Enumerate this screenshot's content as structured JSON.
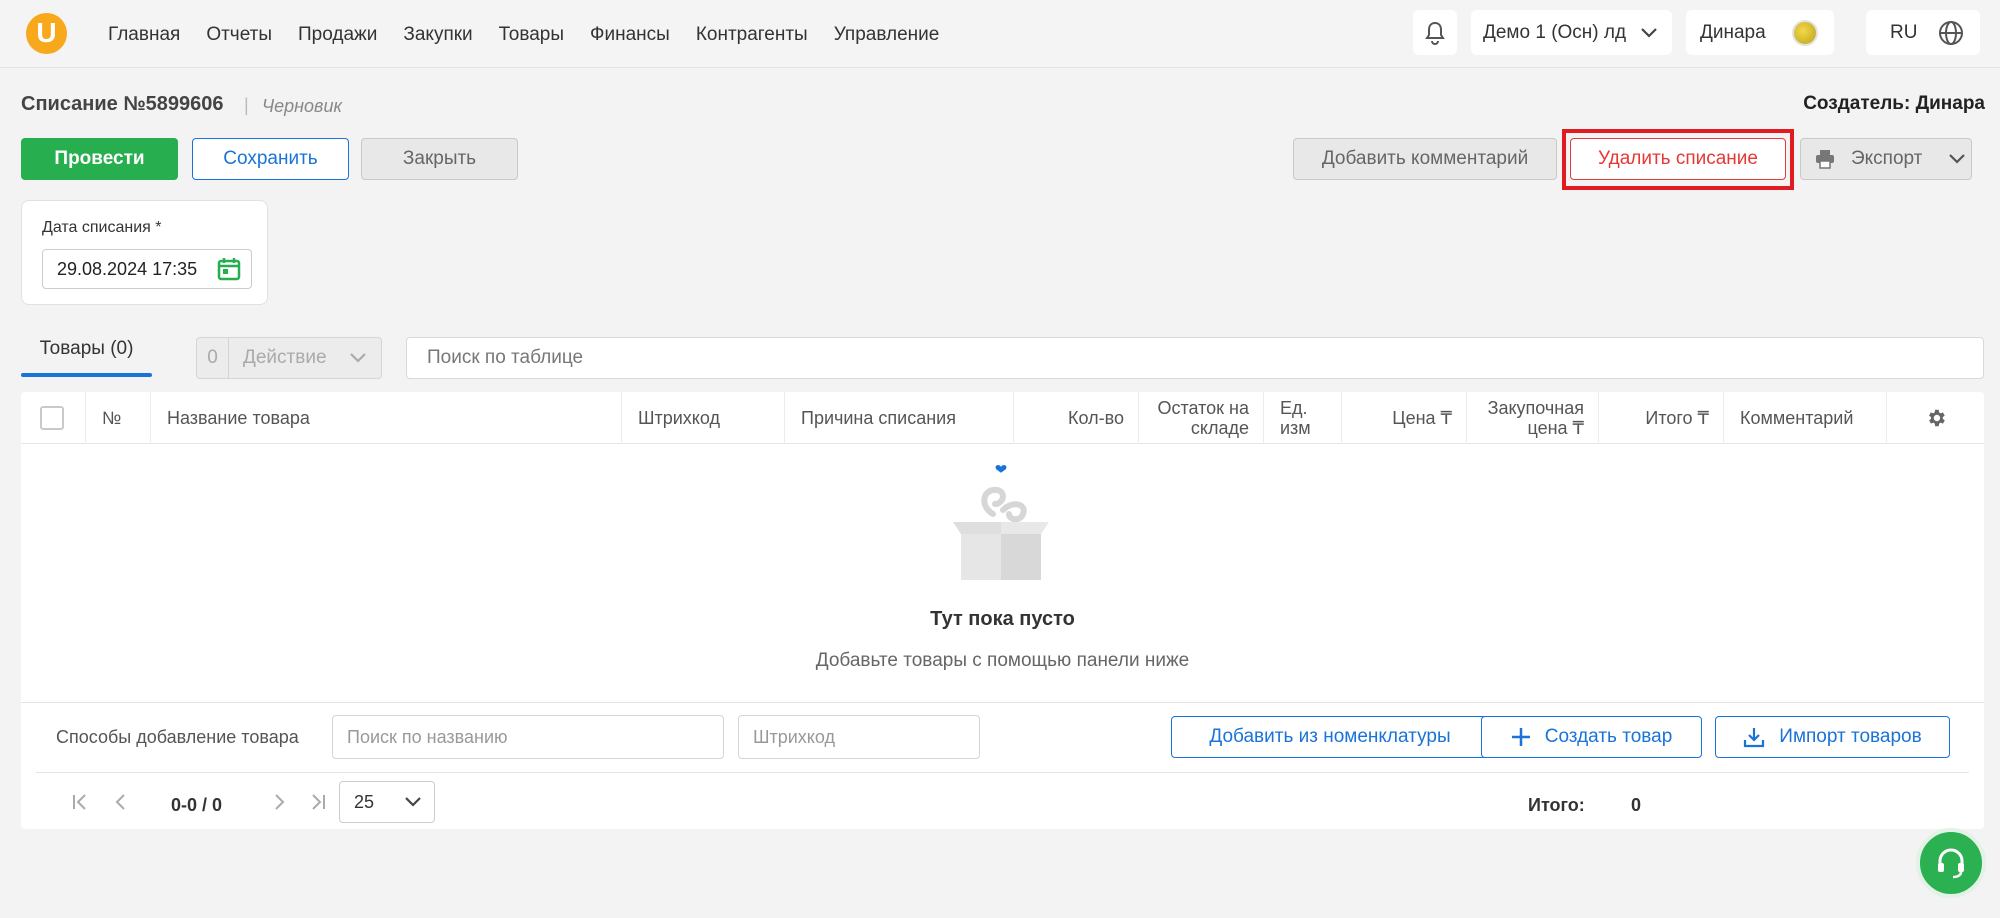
{
  "app": {
    "logo_letter": "U"
  },
  "nav": {
    "items": [
      "Главная",
      "Отчеты",
      "Продажи",
      "Закупки",
      "Товары",
      "Финансы",
      "Контрагенты",
      "Управление"
    ]
  },
  "header": {
    "company": "Демо 1 (Осн) лд",
    "user": "Динара",
    "lang": "RU"
  },
  "doc": {
    "title": "Списание №5899606",
    "separator": "|",
    "status": "Черновик",
    "creator": "Создатель: Динара"
  },
  "toolbar": {
    "conduct": "Провести",
    "save": "Сохранить",
    "close": "Закрыть",
    "add_comment": "Добавить комментарий",
    "delete": "Удалить списание",
    "export": "Экспорт"
  },
  "date_field": {
    "label": "Дата списания *",
    "value": "29.08.2024 17:35"
  },
  "tabs": {
    "goods": "Товары  (0)"
  },
  "action": {
    "count": "0",
    "label": "Действие"
  },
  "table_search": {
    "placeholder": "Поиск по таблице"
  },
  "table": {
    "columns": {
      "num": "№",
      "name": "Название товара",
      "barcode": "Штрихкод",
      "reason": "Причина списания",
      "qty": "Кол-во",
      "stock": "Остаток на складе",
      "unit": "Ед. изм",
      "price": "Цена ₸",
      "purchase": "Закупочная цена ₸",
      "total": "Итого ₸",
      "comment": "Комментарий"
    },
    "empty_title": "Тут пока пусто",
    "empty_subtitle": "Добавьте товары с помощью панели ниже"
  },
  "add_panel": {
    "label": "Способы добавление товара",
    "name_placeholder": "Поиск по названию",
    "barcode_placeholder": "Штрихкод",
    "from_nomenclature": "Добавить из номенклатуры",
    "create": "Создать товар",
    "import": "Импорт товаров"
  },
  "pager": {
    "range": "0-0 / 0",
    "page_size": "25",
    "total_label": "Итого:",
    "total_value": "0"
  },
  "colors": {
    "accent": "#1a73d9",
    "success": "#27ae4f",
    "danger": "#e53935",
    "logo": "#f7a81b"
  }
}
